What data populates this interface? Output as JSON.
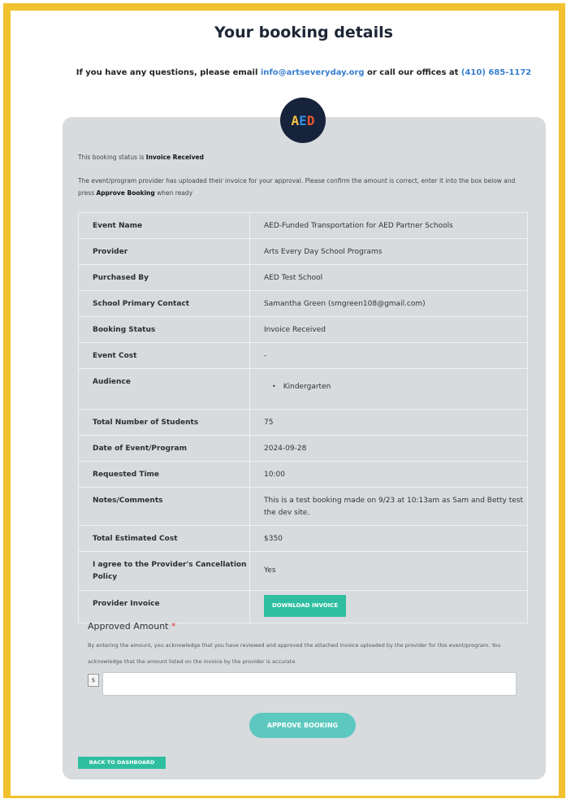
{
  "header": {
    "title": "Your booking details",
    "contact_prefix": "If you have any questions, please email ",
    "email": "info@artseveryday.org",
    "contact_middle": " or call our offices at ",
    "phone": "(410) 685-1172"
  },
  "logo": {
    "letters": [
      "A",
      "E",
      "D"
    ],
    "colors": [
      "#f6c445",
      "#2f8fe0",
      "#e8572d"
    ]
  },
  "status": {
    "prefix": "This booking status is ",
    "value": "Invoice Received"
  },
  "instructions": {
    "text": "The event/program provider has uploaded their invoice for your approval. Please confirm the amount is correct, enter it into the box below and press ",
    "emphasis": "Approve Booking",
    "suffix": " when ready"
  },
  "details": [
    {
      "label": "Event Name",
      "value": "AED-Funded Transportation for AED Partner Schools"
    },
    {
      "label": "Provider",
      "value": "Arts Every Day School Programs"
    },
    {
      "label": "Purchased By",
      "value": "AED Test School"
    },
    {
      "label": "School Primary Contact",
      "value": "Samantha Green (smgreen108@gmail.com)"
    },
    {
      "label": "Booking Status",
      "value": "Invoice Received"
    },
    {
      "label": "Event Cost",
      "value": "-"
    },
    {
      "label": "Audience",
      "list": [
        "Kindergarten"
      ]
    },
    {
      "label": "Total Number of Students",
      "value": "75"
    },
    {
      "label": "Date of Event/Program",
      "value": "2024-09-28"
    },
    {
      "label": "Requested Time",
      "value": "10:00"
    },
    {
      "label": "Notes/Comments",
      "value": "This is a test booking made on 9/23 at 10:13am as Sam and Betty test the dev site."
    },
    {
      "label": "Total Estimated Cost",
      "value": "$350"
    },
    {
      "label": "I agree to the Provider's Cancellation Policy",
      "value": "Yes"
    },
    {
      "label": "Provider Invoice",
      "button": "DOWNLOAD INVOICE"
    }
  ],
  "approved_amount": {
    "label": "Approved Amount",
    "required_mark": "*",
    "note": "By entering the amount, you acknowledge that you have reviewed and approved the attached invoice uploaded by the provider for this event/program. You acknowledge that the amount listed on the invoice by the provider is accurate",
    "currency": "$",
    "value": ""
  },
  "buttons": {
    "approve": "APPROVE BOOKING",
    "back": "BACK TO DASHBOARD"
  }
}
